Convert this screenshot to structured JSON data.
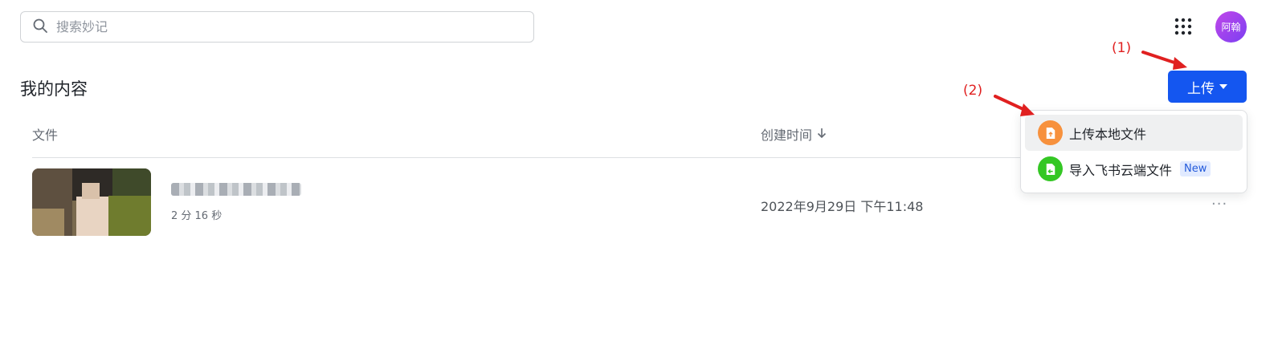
{
  "search": {
    "placeholder": "搜索妙记"
  },
  "header": {
    "avatar_text": "阿翰"
  },
  "main": {
    "title": "我的内容",
    "upload_label": "上传",
    "columns": {
      "file": "文件",
      "created": "创建时间"
    },
    "rows": [
      {
        "duration": "2 分 16 秒",
        "created": "2022年9月29日 下午11:48",
        "more": "···"
      }
    ]
  },
  "upload_menu": {
    "items": [
      {
        "label": "上传本地文件",
        "icon": "upload-file-icon",
        "color": "#f7913d"
      },
      {
        "label": "导入飞书云端文件",
        "icon": "import-file-icon",
        "color": "#34c724",
        "badge": "New"
      }
    ]
  },
  "annotations": {
    "step1": "(1)",
    "step2": "(2)"
  },
  "colors": {
    "primary": "#1456f0",
    "annotation": "#e02020"
  }
}
